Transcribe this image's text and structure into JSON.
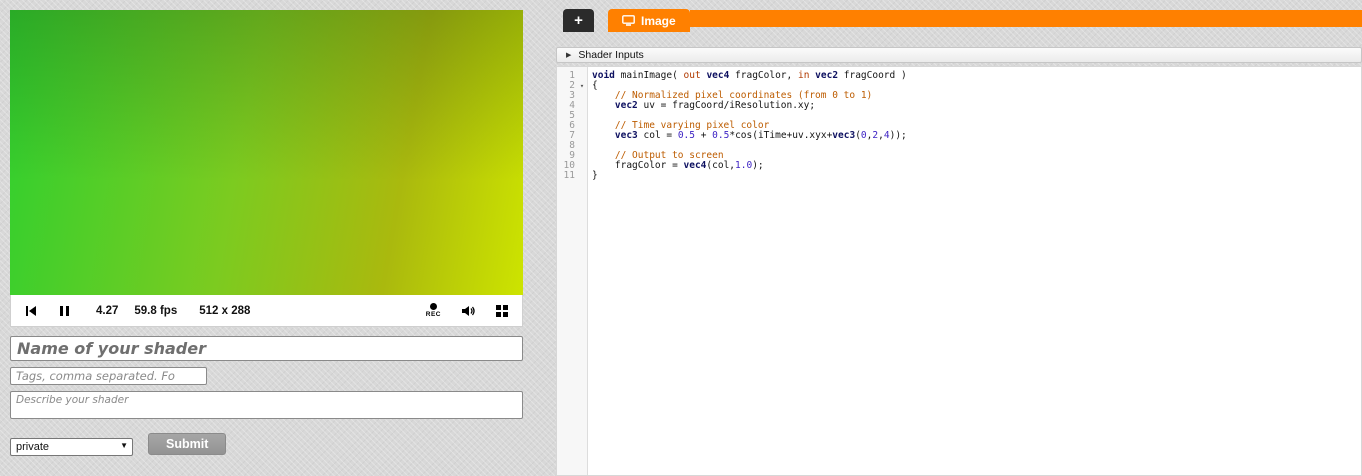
{
  "window": {
    "background": "#d8d8d8"
  },
  "preview": {
    "canvas_colors": {
      "top_left": "#2fae3a",
      "top_right": "#9aa412",
      "bottom_left": "#6fd01f",
      "bottom_right": "#cde400"
    },
    "controls": {
      "time": "4.27",
      "fps": "59.8 fps",
      "resolution": "512 x 288",
      "rec_label": "REC"
    },
    "icons": {
      "rewind": "skip-to-start",
      "pause": "pause-bars",
      "record": "record-dot",
      "volume": "speaker",
      "fullscreen": "expand-corners"
    }
  },
  "form": {
    "name_placeholder": "Name of your shader",
    "tags_placeholder": "Tags, comma separated. Fo",
    "description_placeholder": "Describe your shader",
    "visibility": {
      "value": "private"
    },
    "submit_label": "Submit"
  },
  "editor": {
    "tab_add_label": "+",
    "tab_image_label": "Image",
    "accent_color": "#ff8000",
    "tab_image_icon": "monitor",
    "shader_inputs_label": "Shader Inputs",
    "shader_inputs_icon": "triangle-right",
    "code": {
      "lines": [
        {
          "tokens": [
            [
              "typ",
              "void"
            ],
            [
              "pln",
              " mainImage( "
            ],
            [
              "kw",
              "out"
            ],
            [
              "pln",
              " "
            ],
            [
              "typ",
              "vec4"
            ],
            [
              "pln",
              " fragColor, "
            ],
            [
              "kw",
              "in"
            ],
            [
              "pln",
              " "
            ],
            [
              "typ",
              "vec2"
            ],
            [
              "pln",
              " fragCoord )"
            ]
          ]
        },
        {
          "fold": true,
          "tokens": [
            [
              "pln",
              "{"
            ]
          ]
        },
        {
          "tokens": [
            [
              "com",
              "    // Normalized pixel coordinates (from 0 to 1)"
            ]
          ]
        },
        {
          "tokens": [
            [
              "pln",
              "    "
            ],
            [
              "typ",
              "vec2"
            ],
            [
              "pln",
              " uv = fragCoord/iResolution.xy;"
            ]
          ]
        },
        {
          "tokens": []
        },
        {
          "tokens": [
            [
              "com",
              "    // Time varying pixel color"
            ]
          ]
        },
        {
          "tokens": [
            [
              "pln",
              "    "
            ],
            [
              "typ",
              "vec3"
            ],
            [
              "pln",
              " col = "
            ],
            [
              "num",
              "0.5"
            ],
            [
              "pln",
              " + "
            ],
            [
              "num",
              "0.5"
            ],
            [
              "pln",
              "*cos(iTime+uv.xyx+"
            ],
            [
              "typ",
              "vec3"
            ],
            [
              "pln",
              "("
            ],
            [
              "num",
              "0"
            ],
            [
              "pln",
              ","
            ],
            [
              "num",
              "2"
            ],
            [
              "pln",
              ","
            ],
            [
              "num",
              "4"
            ],
            [
              "pln",
              "));"
            ]
          ]
        },
        {
          "tokens": []
        },
        {
          "tokens": [
            [
              "com",
              "    // Output to screen"
            ]
          ]
        },
        {
          "tokens": [
            [
              "pln",
              "    fragColor = "
            ],
            [
              "typ",
              "vec4"
            ],
            [
              "pln",
              "(col,"
            ],
            [
              "num",
              "1.0"
            ],
            [
              "pln",
              ");"
            ]
          ]
        },
        {
          "tokens": [
            [
              "pln",
              "}"
            ]
          ]
        }
      ]
    }
  }
}
